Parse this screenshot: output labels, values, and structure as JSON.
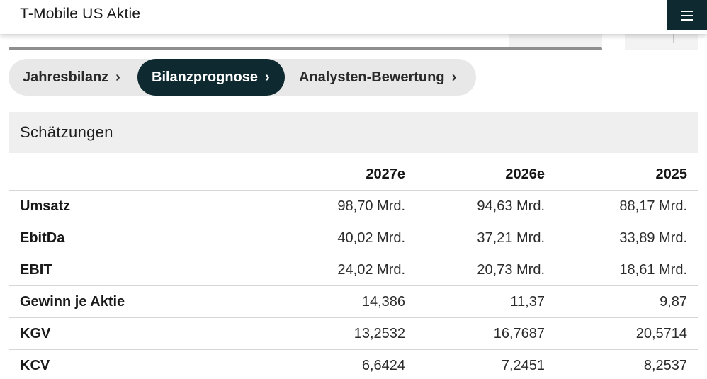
{
  "header": {
    "title": "T-Mobile US Aktie",
    "menu_icon": "hamburger-icon"
  },
  "tabs": [
    {
      "label": "Jahresbilanz",
      "active": false
    },
    {
      "label": "Bilanzprognose",
      "active": true
    },
    {
      "label": "Analysten-Bewertung",
      "active": false
    }
  ],
  "colors": {
    "accent_dark": "#0e2a30",
    "tab_bg": "#e8e8e8",
    "section_bg": "#efefef"
  },
  "section": {
    "title": "Schätzungen"
  },
  "table": {
    "columns": [
      "",
      "2027e",
      "2026e",
      "2025"
    ],
    "rows": [
      {
        "label": "Umsatz",
        "values": [
          "98,70 Mrd.",
          "94,63 Mrd.",
          "88,17 Mrd."
        ]
      },
      {
        "label": "EbitDa",
        "values": [
          "40,02 Mrd.",
          "37,21 Mrd.",
          "33,89 Mrd."
        ]
      },
      {
        "label": "EBIT",
        "values": [
          "24,02 Mrd.",
          "20,73 Mrd.",
          "18,61 Mrd."
        ]
      },
      {
        "label": "Gewinn je Aktie",
        "values": [
          "14,386",
          "11,37",
          "9,87"
        ]
      },
      {
        "label": "KGV",
        "values": [
          "13,2532",
          "16,7687",
          "20,5714"
        ]
      },
      {
        "label": "KCV",
        "values": [
          "6,6424",
          "7,2451",
          "8,2537"
        ]
      }
    ]
  }
}
